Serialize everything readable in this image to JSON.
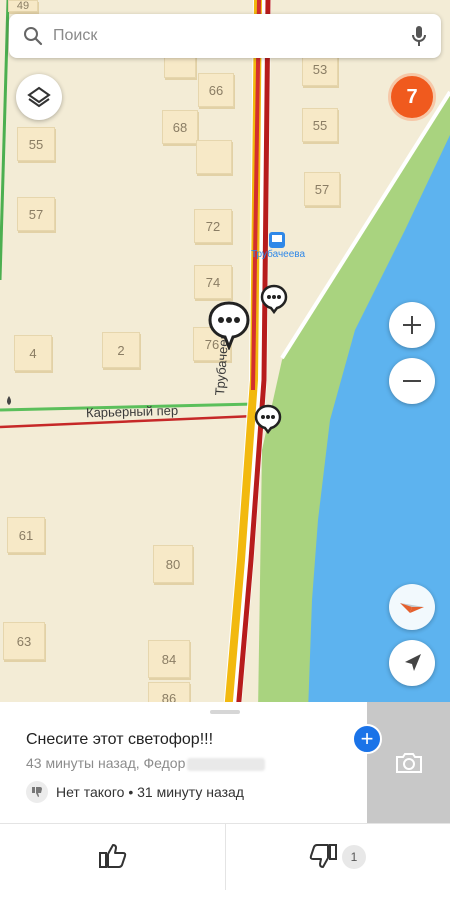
{
  "search": {
    "placeholder": "Поиск"
  },
  "traffic_level": "7",
  "map": {
    "street_main": "Трубачеева",
    "street_side": "Карьерный пер",
    "bus_stop": "Трубачеева",
    "buildings": [
      "49",
      "53",
      "66",
      "68",
      "55",
      "55",
      "57",
      "57",
      "72",
      "74",
      "76",
      "4",
      "2",
      "61",
      "80",
      "63",
      "84",
      "86"
    ]
  },
  "event": {
    "title": "Снесите этот светофор!!!",
    "meta": "43 минуты назад, Федор",
    "reply_text": "Нет такого • 31 минуту назад"
  },
  "votes": {
    "dislike_count": "1"
  },
  "colors": {
    "traffic_badge": "#f05a1e",
    "accent": "#1a73e8",
    "water": "#5fb4ef",
    "park": "#a7d47e"
  }
}
